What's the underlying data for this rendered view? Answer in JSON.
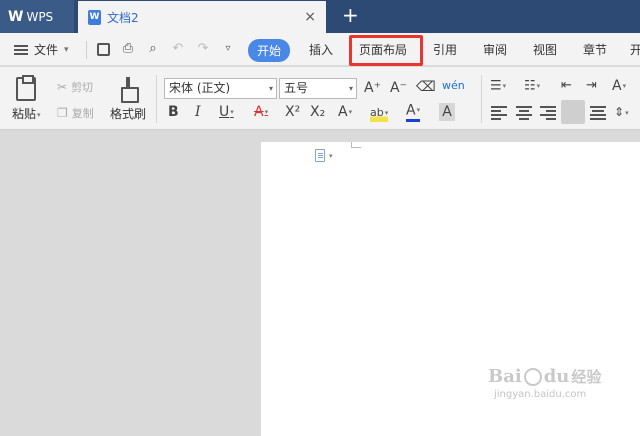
{
  "titlebar": {
    "app_tab": "WPS",
    "doc_tab": "文档2",
    "close_glyph": "×",
    "new_tab_glyph": "+"
  },
  "menubar": {
    "file_label": "文件",
    "tabs": [
      "开始",
      "插入",
      "页面布局",
      "引用",
      "审阅",
      "视图",
      "章节",
      "开"
    ],
    "active_tab": "开始",
    "highlighted_tab": "页面布局"
  },
  "ribbon": {
    "paste_label": "粘贴",
    "cut_label": "剪切",
    "copy_label": "复制",
    "format_painter_label": "格式刷",
    "font_name": "宋体 (正文)",
    "font_size": "五号",
    "grow_font": "A⁺",
    "shrink_font": "A⁻",
    "phonetic": "wén",
    "bold": "B",
    "italic": "I",
    "underline": "U",
    "strike": "A",
    "superscript": "X²",
    "subscript": "X₂",
    "effect": "A",
    "highlight": "ab",
    "font_color": "A",
    "char_shading": "A"
  },
  "watermark": {
    "brand": "Bai",
    "brand_end": "du",
    "cn": "经验",
    "url": "jingyan.baidu.com"
  },
  "colors": {
    "titlebar_bg": "#2c4a73",
    "accent": "#4a88e8",
    "highlight_box": "#e8362f"
  }
}
